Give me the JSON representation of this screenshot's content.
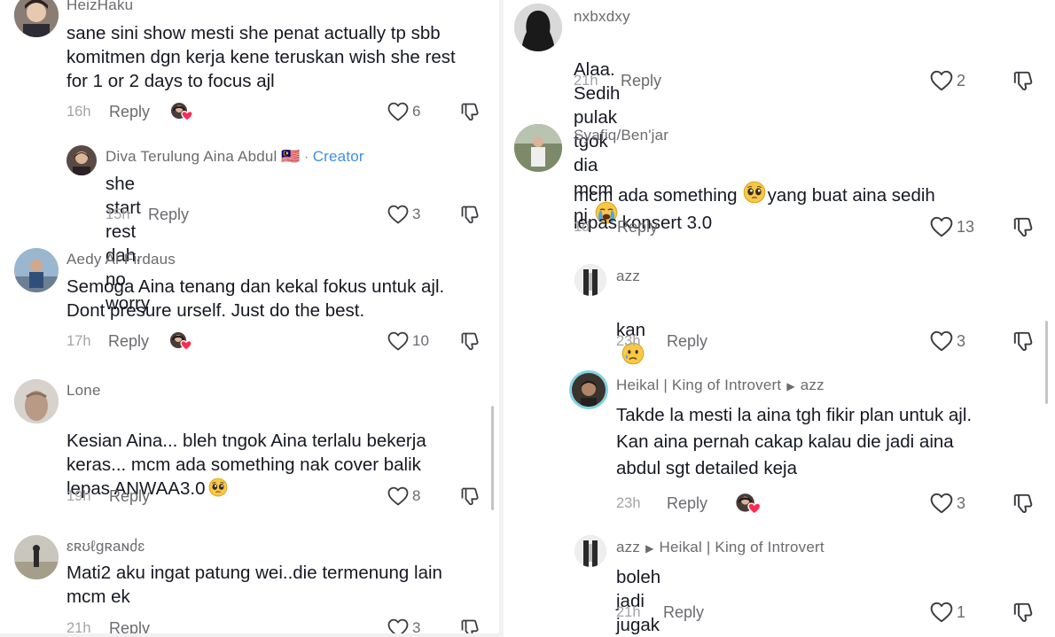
{
  "left": {
    "comments": [
      {
        "username": "HeizHaku",
        "text": "sane sini show mesti she penat actually tp sbb\nkomitmen dgn kerja kene teruskan wish she rest\nfor 1 or 2 days to focus ajl",
        "time": "16h",
        "reply": "Reply",
        "likes": "6"
      },
      {
        "username": "Diva Terulung Aina Abdul 🇲🇾",
        "creator_sep": "·",
        "creator_label": "Creator",
        "text": "she start rest dah, no worry",
        "time": "15h",
        "reply": "Reply",
        "likes": "3"
      },
      {
        "username": "Aedy Al-Firdaus",
        "text": "Semoga Aina tenang dan kekal fokus untuk ajl.\nDont presure urself. Just do the best.",
        "time": "17h",
        "reply": "Reply",
        "likes": "10"
      },
      {
        "username": "Lone",
        "text": "Kesian Aina... bleh tngok Aina terlalu bekerja\nkeras... mcm ada something nak cover balik\nlepas ANWAA3.0",
        "time": "19h",
        "reply": "Reply",
        "likes": "8"
      },
      {
        "username": "ɛʀʊℓɡʀaɴძɛ",
        "text": "Mati2 aku ingat patung wei..die termenung lain\nmcm ek",
        "time": "21h",
        "reply": "Reply",
        "likes": "3"
      }
    ]
  },
  "right": {
    "comments": [
      {
        "username": "nxbxdxy",
        "text": "Alaa. Sedih pulak tgok dia mcm ni",
        "time": "21h",
        "reply": "Reply",
        "likes": "2"
      },
      {
        "username": "Syafiq/Ben'jar",
        "text_a": "mcm ada something",
        "text_b": "yang buat aina sedih",
        "text_c": "lepas konsert 3.0",
        "time": "1d",
        "reply": "Reply",
        "likes": "13"
      },
      {
        "username": "azz",
        "text": "kan",
        "time": "23h",
        "reply": "Reply",
        "likes": "3"
      },
      {
        "username": "Heikal | King of Introvert",
        "reply_to": "azz",
        "text": "Takde la mesti la aina tgh fikir plan untuk ajl.\nKan aina pernah cakap kalau die jadi aina\nabdul sgt detailed keja",
        "time": "23h",
        "reply": "Reply",
        "likes": "3"
      },
      {
        "username": "azz",
        "reply_to": "Heikal | King of Introvert",
        "text": "boleh jadi jugak kan",
        "time": "21h",
        "reply": "Reply",
        "likes": "1"
      }
    ]
  },
  "colors": {
    "text": "#161823",
    "muted": "#6b6b70",
    "time": "#a4a4a8",
    "creator": "#3e8fe6",
    "heart_liked": "#fe2c55"
  },
  "icons": [
    "heart-outline-icon",
    "dislike-icon",
    "creator-liked-icon",
    "pleading-emoji-icon",
    "crying-emoji-icon",
    "sad-tear-emoji-icon",
    "malaysia-flag-icon"
  ]
}
